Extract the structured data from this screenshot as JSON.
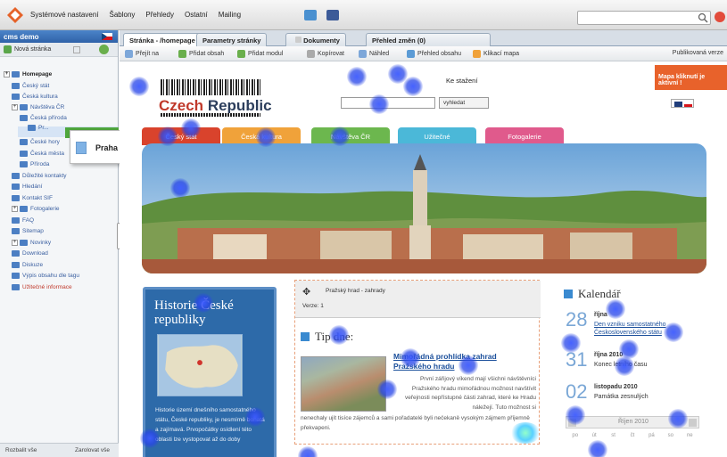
{
  "topbar": {
    "menu": [
      "Systémové nastavení",
      "Šablony",
      "Přehledy",
      "Ostatní",
      "Mailing"
    ]
  },
  "leftpanel": {
    "site_name": "cms demo",
    "toolbar_new": "Nová stránka",
    "tree": [
      {
        "label": "Homepage",
        "level": 0,
        "root": true
      },
      {
        "label": "Český stát",
        "level": 1
      },
      {
        "label": "Česká kultura",
        "level": 1
      },
      {
        "label": "Návštěva ČR",
        "level": 1
      },
      {
        "label": "Česká příroda",
        "level": 2
      },
      {
        "label": "Pr...",
        "level": 3
      },
      {
        "label": "České hory",
        "level": 2
      },
      {
        "label": "Česká města",
        "level": 2
      },
      {
        "label": "Příroda",
        "level": 2
      },
      {
        "label": "Důležité kontakty",
        "level": 1
      },
      {
        "label": "Hledání",
        "level": 1
      },
      {
        "label": "Kontakt SIF",
        "level": 1
      },
      {
        "label": "Fotogalerie",
        "level": 1
      },
      {
        "label": "FAQ",
        "level": 1
      },
      {
        "label": "Sitemap",
        "level": 1
      },
      {
        "label": "Novinky",
        "level": 1
      },
      {
        "label": "Download",
        "level": 1
      },
      {
        "label": "Diskuze",
        "level": 1
      },
      {
        "label": "Výpis obsahu dle tagu",
        "level": 1
      },
      {
        "label": "Užitečné informace",
        "level": 1,
        "red": true
      }
    ],
    "popup_label": "Praha",
    "expand_all": "Rozbalit vše",
    "collapse_all": "Zarolovat vše"
  },
  "tabs": [
    {
      "label": "Stránka - /homepage",
      "active": true
    },
    {
      "label": "Parametry stránky"
    },
    {
      "label": "Dokumenty"
    },
    {
      "label": "Přehled změn (0)"
    }
  ],
  "toolbar": {
    "items": [
      "Přejít na",
      "Přidat obsah",
      "Přidat modul",
      "Kopírovat",
      "Náhled",
      "Přehled obsahu",
      "Klikací mapa"
    ],
    "published": "Publikovaná verze"
  },
  "page": {
    "map_notice": "Mapa kliknutí je aktivní !",
    "brand_1": "Czech",
    "brand_2": "Republic",
    "link_1": "Ke stažení",
    "search_button": "vyhledat",
    "nav_tabs": [
      {
        "label": "Český stát",
        "color": "#d9432c"
      },
      {
        "label": "Česká kultura",
        "color": "#f0a23a"
      },
      {
        "label": "Návštěva ČR",
        "color": "#6cb74e"
      },
      {
        "label": "Užitečné",
        "color": "#4bb8d8"
      },
      {
        "label": "Fotogalerie",
        "color": "#e05a8c"
      }
    ],
    "history_title": "Historie České republiky",
    "history_text": "Historie území dnešního samostatného státu, České republiky, je nesmírně bohatá a zajímavá. Prvopočátky osídlení této oblasti lze vystopovat až do doby",
    "edit_page_title": "Pražský hrad - zahrady",
    "edit_version": "Verze: 1",
    "tip_heading": "Tip dne:",
    "article_title": "Mimořádná prohlídka zahrad Pražského hradu",
    "article_text": "První zářijový víkend mají všichni návštěvníci Pražského hradu mimořádnou možnost navštívit veřejnosti nepřístupné části zahrad, které ke Hradu náležejí. Tuto možnost si",
    "article_text2": "nenechaly ujít tisíce zájemců a sami pořadatelé byli nečekaně vysokým zájmem příjemně překvapeni.",
    "calendar_title": "Kalendář",
    "events": [
      {
        "day": "28",
        "date": "října",
        "text": "Den vzniku samostatného Československého státu",
        "link": true
      },
      {
        "day": "31",
        "date": "října 2010",
        "text": "Konec letního času",
        "link": false
      },
      {
        "day": "02",
        "date": "listopadu 2010",
        "text": "Památka zesnulých",
        "link": false
      }
    ],
    "calendar_month": "Říjen 2010",
    "weekdays": [
      "po",
      "út",
      "st",
      "čt",
      "pá",
      "so",
      "ne"
    ]
  },
  "colors": {
    "accent_blue": "#2f62a8",
    "map_notice": "#e8622b",
    "history_bg": "#2d6aa9"
  }
}
